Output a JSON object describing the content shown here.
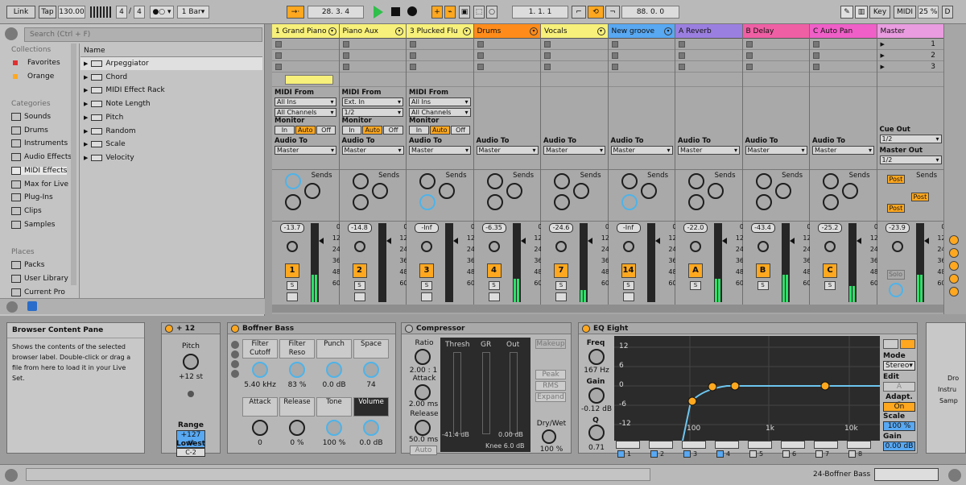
{
  "transport": {
    "link": "Link",
    "tap": "Tap",
    "tempo": "130.00",
    "meter_sig": "4",
    "meter_den": "4",
    "quant": "1 Bar",
    "position": "28.   3.   4",
    "loop_pos": "1.   1.   1",
    "loop_len": "88.   0.   0",
    "key": "Key",
    "midi": "MIDI",
    "cpu": "25 %",
    "d": "D"
  },
  "browser": {
    "search_placeholder": "Search (Ctrl + F)",
    "collections_header": "Collections",
    "collections": [
      "Favorites",
      "Orange"
    ],
    "categories_header": "Categories",
    "categories": [
      "Sounds",
      "Drums",
      "Instruments",
      "Audio Effects",
      "MIDI Effects",
      "Max for Live",
      "Plug-Ins",
      "Clips",
      "Samples"
    ],
    "places_header": "Places",
    "places": [
      "Packs",
      "User Library",
      "Current Pro"
    ],
    "list_header": "Name",
    "list": [
      "Arpeggiator",
      "Chord",
      "MIDI Effect Rack",
      "Note Length",
      "Pitch",
      "Random",
      "Scale",
      "Velocity"
    ],
    "colors": {
      "favorites": "#e03030",
      "orange": "#ffa81f"
    }
  },
  "tracks": [
    {
      "name": "1 Grand Piano",
      "color": "#f7f07a",
      "type": "midi",
      "input_label": "MIDI From",
      "input": "All Ins",
      "channel": "All Channels",
      "vol": "-13.7",
      "num": "1",
      "meter": 0.35
    },
    {
      "name": "Piano Aux",
      "color": "#f7f07a",
      "type": "midi",
      "input_label": "MIDI From",
      "input": "Ext. In",
      "channel": "1/2",
      "vol": "-14.8",
      "num": "2",
      "meter": 0
    },
    {
      "name": "3 Plucked Flu",
      "color": "#f7f07a",
      "type": "midi",
      "input_label": "MIDI From",
      "input": "All Ins",
      "channel": "All Channels",
      "vol": "-Inf",
      "num": "3",
      "meter": 0
    },
    {
      "name": "Drums",
      "color": "#ff8c1a",
      "type": "audio",
      "vol": "-6.35",
      "num": "4",
      "meter": 0.3
    },
    {
      "name": "Vocals",
      "color": "#f7f07a",
      "type": "audio",
      "vol": "-24.6",
      "num": "7",
      "meter": 0.15
    },
    {
      "name": "New groove",
      "color": "#58a8f2",
      "type": "audio",
      "vol": "-Inf",
      "num": "14",
      "meter": 0
    },
    {
      "name": "A Reverb",
      "color": "#9b7fe0",
      "type": "return",
      "vol": "-22.0",
      "num": "A",
      "meter": 0.3
    },
    {
      "name": "B Delay",
      "color": "#ef5fa4",
      "type": "return",
      "vol": "-43.4",
      "num": "B",
      "meter": 0.35
    },
    {
      "name": "C Auto Pan",
      "color": "#ef5fc7",
      "type": "return",
      "vol": "-25.2",
      "num": "C",
      "meter": 0.2
    },
    {
      "name": "Master",
      "color": "#e99ce0",
      "type": "master",
      "vol": "-23.9",
      "num": "",
      "meter": 0.35
    }
  ],
  "mixer_labels": {
    "monitor": "Monitor",
    "audio_to": "Audio To",
    "master": "Master",
    "sends": "Sends",
    "in": "In",
    "auto": "Auto",
    "off": "Off",
    "cue_out": "Cue Out",
    "cue": "1/2",
    "master_out": "Master Out",
    "master_out_val": "1/2",
    "post": "Post",
    "solo": "Solo",
    "s": "S",
    "scale": [
      "0",
      "12",
      "24",
      "36",
      "48",
      "60"
    ],
    "scene": [
      "1",
      "2",
      "3"
    ]
  },
  "info": {
    "title": "Browser Content Pane",
    "text": "Shows the contents of the selected browser label. Double-click or drag a file from here to load it in your Live Set."
  },
  "pitch_dev": {
    "name": "+ 12",
    "pitch": "Pitch",
    "pitch_val": "+12 st",
    "range": "Range",
    "range_val": "+127 st",
    "lowest": "Lowest",
    "lowest_val": "C-2"
  },
  "bass_dev": {
    "name": "Boffner Bass",
    "labels": [
      "Filter Cutoff",
      "Filter Reso",
      "Punch",
      "Space",
      "Attack",
      "Release",
      "Tone",
      "Volume"
    ],
    "values": [
      "5.40 kHz",
      "83 %",
      "0.0 dB",
      "74",
      "0",
      "0 %",
      "100 %",
      "0.0 dB"
    ]
  },
  "comp_dev": {
    "name": "Compressor",
    "ratio": "Ratio",
    "ratio_val": "2.00 : 1",
    "attack": "Attack",
    "attack_val": "2.00 ms",
    "release": "Release",
    "release_val": "50.0 ms",
    "auto": "Auto",
    "thresh": "Thresh",
    "gr": "GR",
    "out": "Out",
    "thresh_val": "-41.4 dB",
    "out_val": "0.00 dB",
    "knee": "Knee 6.0 dB",
    "makeup": "Makeup",
    "peak": "Peak",
    "rms": "RMS",
    "expand": "Expand",
    "drywet": "Dry/Wet",
    "drywet_val": "100 %"
  },
  "eq_dev": {
    "name": "EQ Eight",
    "freq": "Freq",
    "freq_val": "167 Hz",
    "gain": "Gain",
    "gain_val": "-0.12 dB",
    "q": "Q",
    "q_val": "0.71",
    "y_ticks": [
      "12",
      "6",
      "0",
      "-6",
      "-12"
    ],
    "x_ticks": [
      "100",
      "1k",
      "10k"
    ],
    "bands": [
      "1",
      "2",
      "3",
      "4",
      "5",
      "6",
      "7",
      "8"
    ],
    "mode": "Mode",
    "mode_val": "Stereo",
    "edit": "Edit",
    "edit_val": "A",
    "adapt": "Adapt. Q",
    "adapt_val": "On",
    "scale": "Scale",
    "scale_val": "100 %",
    "out_gain": "Gain",
    "out_gain_val": "0.00 dB"
  },
  "side": {
    "text1": "Dro",
    "text2": "Instru",
    "text3": "Samp"
  },
  "status": {
    "track": "24-Boffner Bass"
  }
}
